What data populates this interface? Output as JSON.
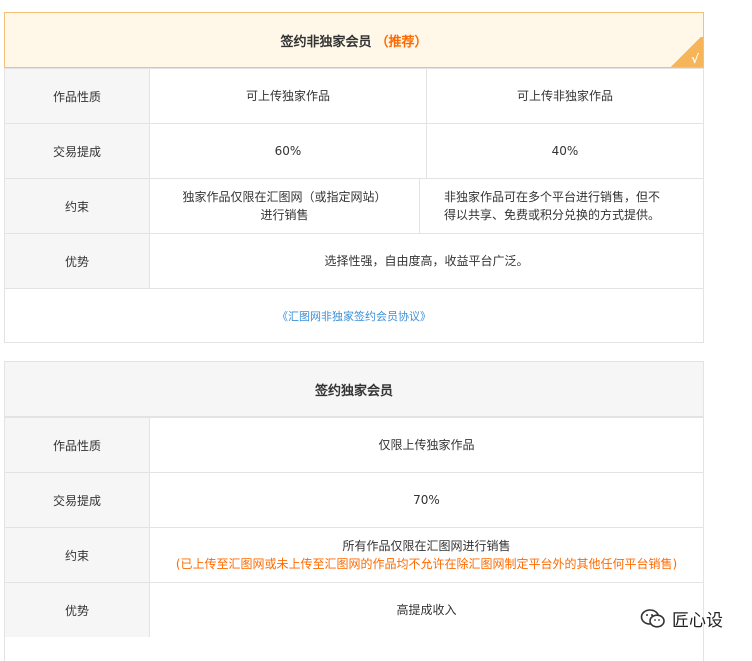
{
  "card1": {
    "title": "签约非独家会员",
    "badge": "（推荐）",
    "check": "√",
    "rows": [
      {
        "label": "作品性质",
        "a": "可上传独家作品",
        "b": "可上传非独家作品"
      },
      {
        "label": "交易提成",
        "a": "60%",
        "b": "40%"
      },
      {
        "label": "约束",
        "a1": "独家作品仅限在汇图网（或指定网站）",
        "a2": "进行销售",
        "b1": "非独家作品可在多个平台进行销售，但不",
        "b2": "得以共享、免费或积分兑换的方式提供。"
      },
      {
        "label": "优势",
        "full": "选择性强，自由度高，收益平台广泛。"
      }
    ],
    "link": "《汇图网非独家签约会员协议》"
  },
  "card2": {
    "title": "签约独家会员",
    "rows": [
      {
        "label": "作品性质",
        "full": "仅限上传独家作品"
      },
      {
        "label": "交易提成",
        "full": "70%"
      },
      {
        "label": "约束",
        "line1": "所有作品仅限在汇图网进行销售",
        "line2": "(已上传至汇图网或未上传至汇图网的作品均不允许在除汇图网制定平台外的其他任何平台销售)"
      },
      {
        "label": "优势",
        "full": "高提成收入"
      }
    ]
  },
  "watermark": {
    "text": "匠心设",
    "icon": "wechat-icon"
  },
  "colors": {
    "accent": "#ff6a00",
    "link": "#3a8fd9",
    "highlight_bg": "#fff8e9",
    "corner": "#f7b55a"
  }
}
